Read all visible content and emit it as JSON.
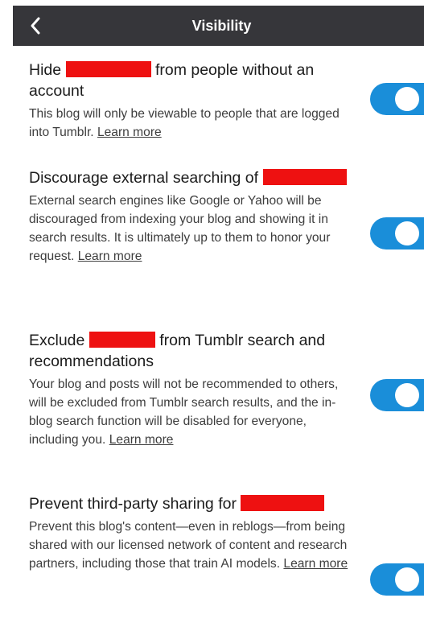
{
  "header": {
    "title": "Visibility",
    "back_icon": "chevron-left-icon"
  },
  "sections": [
    {
      "title_pre": "Hide",
      "title_post": " from people without an account",
      "description": "This blog will only be viewable to people that are logged into Tumblr.",
      "learn_more": "Learn more",
      "toggle_on": true
    },
    {
      "title_pre": "Discourage external searching of",
      "title_post": "",
      "description": "External search engines like Google or Yahoo will be discouraged from indexing your blog and showing it in search results. It is ultimately up to them to honor your request.",
      "learn_more": "Learn more",
      "toggle_on": true
    },
    {
      "title_pre": "Exclude",
      "title_post": " from Tumblr search and recommendations",
      "description": "Your blog and posts will not be recommended to others, will be excluded from Tumblr search results, and the in-blog search function will be disabled for everyone, including you.",
      "learn_more": "Learn more",
      "toggle_on": true
    },
    {
      "title_pre": "Prevent third-party sharing for",
      "title_post": "",
      "description": "Prevent this blog's content—even in reblogs—from being shared with our licensed network of content and research partners, including those that train AI models.",
      "learn_more": "Learn more",
      "toggle_on": true
    }
  ],
  "colors": {
    "header_bg": "#36363a",
    "toggle_on": "#1a8ed9",
    "redaction": "#ee1111"
  }
}
